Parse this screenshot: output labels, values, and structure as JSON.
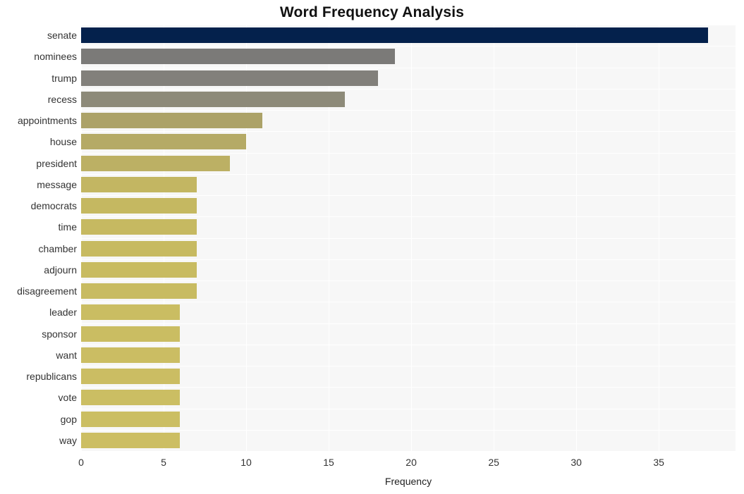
{
  "chart_data": {
    "type": "bar",
    "orientation": "horizontal",
    "title": "Word Frequency Analysis",
    "xlabel": "Frequency",
    "ylabel": "",
    "categories": [
      "senate",
      "nominees",
      "trump",
      "recess",
      "appointments",
      "house",
      "president",
      "message",
      "democrats",
      "time",
      "chamber",
      "adjourn",
      "disagreement",
      "leader",
      "sponsor",
      "want",
      "republicans",
      "vote",
      "gop",
      "way"
    ],
    "values": [
      38,
      19,
      18,
      16,
      11,
      10,
      9,
      7,
      7,
      7,
      7,
      7,
      7,
      6,
      6,
      6,
      6,
      6,
      6,
      6
    ],
    "bar_colors": [
      "#04214c",
      "#7b7a78",
      "#82807b",
      "#8d8a79",
      "#aca268",
      "#b5aa66",
      "#bcb064",
      "#c3b662",
      "#c5b861",
      "#c6b961",
      "#c7ba61",
      "#c8bb61",
      "#c8bb61",
      "#cabd62",
      "#cabd62",
      "#cbbd63",
      "#cbbd63",
      "#cbbe63",
      "#cbbe63",
      "#ccbe63"
    ],
    "xticks": [
      0,
      5,
      10,
      15,
      20,
      25,
      30,
      35
    ],
    "xlim": [
      0,
      39.65
    ],
    "grid": true,
    "legend": false,
    "plot_background": "#f7f7f7",
    "gridline_color": "#ffffff",
    "figure_background": "#ffffff"
  }
}
